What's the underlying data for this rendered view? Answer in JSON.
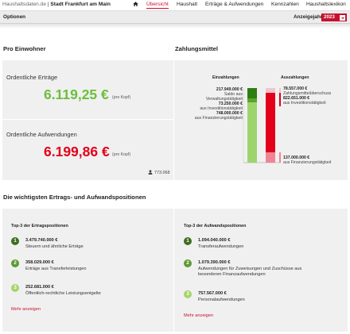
{
  "header": {
    "site": "Haushaltsdaten.de",
    "separator": " | ",
    "city": "Stadt Frankfurt am Main",
    "nav": [
      "Übersicht",
      "Haushalt",
      "Erträge & Aufwendungen",
      "Kennzahlen",
      "Haushaltslexikon"
    ],
    "active_nav": "Übersicht",
    "home_icon": "home-icon"
  },
  "options_bar": {
    "options_label": "Optionen",
    "year_label": "Anzeigejahr",
    "year_value": "2023"
  },
  "pro_einwohner": {
    "title": "Pro Einwohner",
    "ertraege_label": "Ordentliche Erträge",
    "ertraege_value": "6.119,25 €",
    "aufwendungen_label": "Ordentliche Aufwendungen",
    "aufwendungen_value": "6.199,86 €",
    "per_capita": "(pro Kopf)",
    "population": "773.068",
    "population_icon": "person-icon"
  },
  "zahlungsmittel": {
    "title": "Zahlungsmittel",
    "einzahlungen_label": "Einzahlungen",
    "auszahlungen_label": "Auszahlungen",
    "einzahlungen_items": [
      {
        "value": "217.949.000 €",
        "desc_lines": [
          "Saldo aus",
          "Verwaltungstätigkeit"
        ]
      },
      {
        "value": "73.250.000 €",
        "desc_lines": [
          "aus Investitionstätigkeit"
        ]
      },
      {
        "value": "748.000.000 €",
        "desc_lines": [
          "aus Finanzierungstätigkeit"
        ]
      }
    ],
    "auszahlungen_items": [
      {
        "value": "78.557.000 €",
        "desc_lines": [
          "Zahlungsmittelüberschuss"
        ]
      },
      {
        "value": "822.651.000 €",
        "desc_lines": [
          "aus Investitionstätigkeit"
        ]
      },
      {
        "value": "137.000.000 €",
        "desc_lines": [
          "aus Finanzierungstätigkeit"
        ]
      }
    ],
    "colors": {
      "ein_dark": "#2f7d14",
      "ein_light": "#9ed46d",
      "aus_light": "#f5c3cc",
      "aus_red": "#e2001a"
    }
  },
  "positions": {
    "title": "Die wichtigsten Ertrags- und Aufwandspositionen",
    "ertrag": {
      "title": "Top-3 der Ertragspositionen",
      "items": [
        {
          "rank": "1",
          "value": "3.479.740.000 €",
          "desc": "Steuern und ähnliche Erträge"
        },
        {
          "rank": "2",
          "value": "358.029.000 €",
          "desc": "Erträge aus Transferleistungen"
        },
        {
          "rank": "3",
          "value": "252.681.000 €",
          "desc": "Öffentlich-rechtliche Leistungsentgelte"
        }
      ],
      "more": "Mehr anzeigen"
    },
    "aufwand": {
      "title": "Top-3 der Aufwandspositionen",
      "items": [
        {
          "rank": "1",
          "value": "1.094.040.000 €",
          "desc": "Transferaufwendungen"
        },
        {
          "rank": "2",
          "value": "1.079.390.000 €",
          "desc": "Aufwendungen für Zuweisungen und Zuschüsse aus besonderen Finanzaufwendungen"
        },
        {
          "rank": "3",
          "value": "757.567.000 €",
          "desc": "Personalaufwendungen"
        }
      ],
      "more": "Mehr anzeigen"
    }
  }
}
